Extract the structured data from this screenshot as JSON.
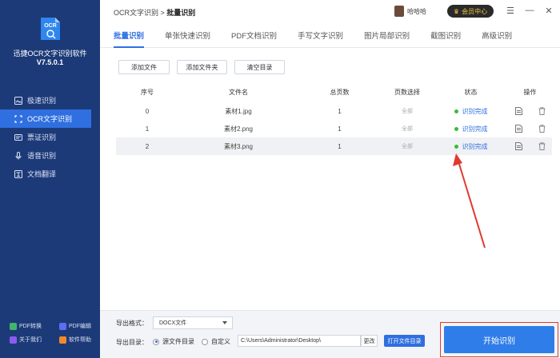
{
  "app": {
    "name": "迅捷OCR文字识别软件",
    "version": "V7.5.0.1",
    "logo_text": "OCR"
  },
  "colors": {
    "sidebar_bg": "#1d3a78",
    "accent": "#2f6fe0",
    "success": "#3bba3b",
    "highlight_red": "#e03a2f"
  },
  "sidebar": {
    "items": [
      {
        "label": "极速识别",
        "icon": "image-icon",
        "active": false
      },
      {
        "label": "OCR文字识别",
        "icon": "ocr-icon",
        "active": true
      },
      {
        "label": "票证识别",
        "icon": "ticket-icon",
        "active": false
      },
      {
        "label": "语音识别",
        "icon": "microphone-icon",
        "active": false
      },
      {
        "label": "文档翻译",
        "icon": "translate-icon",
        "active": false
      }
    ],
    "bottom_links": [
      {
        "label": "PDF转换",
        "icon": "pdf-convert-icon",
        "color": "#3fb66b"
      },
      {
        "label": "PDF编辑",
        "icon": "pdf-edit-icon",
        "color": "#5b6ff0"
      },
      {
        "label": "关于我们",
        "icon": "about-icon",
        "color": "#8a5cf0"
      },
      {
        "label": "软件帮助",
        "icon": "help-icon",
        "color": "#f08a2a"
      }
    ]
  },
  "header": {
    "breadcrumb_root": "OCR文字识别",
    "breadcrumb_separator": " > ",
    "breadcrumb_current": "批量识别",
    "username": "哈哈哈",
    "vip_label": "会员中心"
  },
  "tabs": [
    {
      "label": "批量识别",
      "active": true
    },
    {
      "label": "单张快速识别",
      "active": false
    },
    {
      "label": "PDF文档识别",
      "active": false
    },
    {
      "label": "手写文字识别",
      "active": false
    },
    {
      "label": "图片局部识别",
      "active": false
    },
    {
      "label": "截图识别",
      "active": false
    },
    {
      "label": "高级识别",
      "active": false
    }
  ],
  "toolbar": {
    "add_file": "添加文件",
    "add_folder": "添加文件夹",
    "clear_list": "清空目录"
  },
  "table": {
    "columns": [
      "序号",
      "文件名",
      "总页数",
      "页数选择",
      "状态",
      "操作"
    ],
    "rows": [
      {
        "index": "0",
        "filename": "素材1.jpg",
        "pages": "1",
        "page_select": "全部",
        "status": "识别完成"
      },
      {
        "index": "1",
        "filename": "素材2.png",
        "pages": "1",
        "page_select": "全部",
        "status": "识别完成"
      },
      {
        "index": "2",
        "filename": "素材3.png",
        "pages": "1",
        "page_select": "全部",
        "status": "识别完成"
      }
    ]
  },
  "export": {
    "format_label": "导出格式：",
    "format_value": "DOCX文件",
    "dir_label": "导出目录：",
    "radio_source": "源文件目录",
    "radio_custom": "自定义",
    "path_value": "C:\\Users\\Administrator\\Desktop\\",
    "change_label": "更改",
    "open_folder_label": "打开文件目录",
    "start_label": "开始识别"
  }
}
